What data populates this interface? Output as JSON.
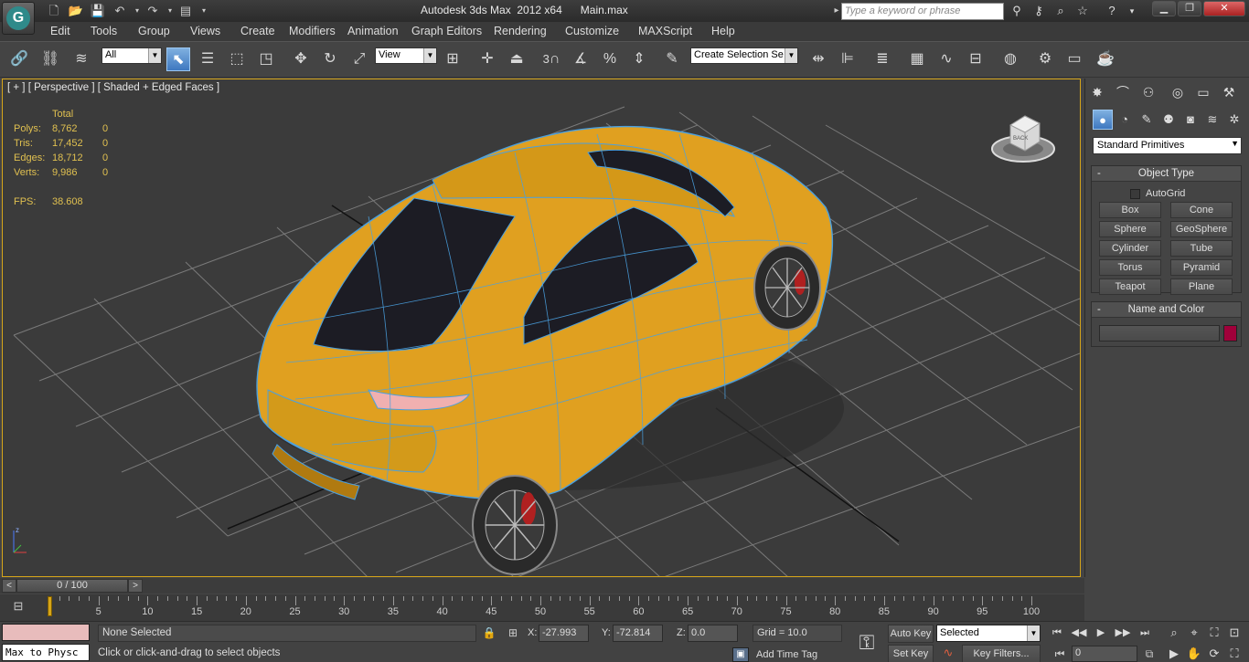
{
  "title_bar": {
    "title": "Autodesk 3ds Max  2012 x64      Main.max",
    "search_placeholder": "Type a keyword or phrase",
    "logo_glyph": "G"
  },
  "menu": {
    "items": [
      "Edit",
      "Tools",
      "Group",
      "Views",
      "Create",
      "Modifiers",
      "Animation",
      "Graph Editors",
      "Rendering",
      "Customize",
      "MAXScript",
      "Help"
    ]
  },
  "toolbar": {
    "selection_filter": "All",
    "reference_coord": "View",
    "named_selection_set": "Create Selection Se",
    "snap_label": "3",
    "percent_snap_label": "%"
  },
  "viewport": {
    "label": "[ + ] [ Perspective ] [ Shaded + Edged Faces ]",
    "stats": {
      "header": "Total",
      "rows": [
        {
          "label": "Polys:",
          "total": "8,762",
          "selected": "0"
        },
        {
          "label": "Tris:",
          "total": "17,452",
          "selected": "0"
        },
        {
          "label": "Edges:",
          "total": "18,712",
          "selected": "0"
        },
        {
          "label": "Verts:",
          "total": "9,986",
          "selected": "0"
        }
      ],
      "fps_label": "FPS:",
      "fps_value": "38.608"
    },
    "viewcube_label": "BACK",
    "colors": {
      "car_body": "#e0a020",
      "wireframe": "#4aa0e0",
      "glass": "#1c1c24",
      "grid": "#7a7a7a",
      "frame": "#d6a519"
    }
  },
  "command_panel": {
    "category": "Standard Primitives",
    "object_type": {
      "title": "Object Type",
      "autogrid": "AutoGrid",
      "buttons": [
        "Box",
        "Cone",
        "Sphere",
        "GeoSphere",
        "Cylinder",
        "Tube",
        "Torus",
        "Pyramid",
        "Teapot",
        "Plane"
      ]
    },
    "name_and_color": {
      "title": "Name and Color",
      "swatch_color": "#a0003a"
    }
  },
  "timeline": {
    "current": "0 / 100",
    "ticks": [
      "5",
      "10",
      "15",
      "20",
      "25",
      "30",
      "35",
      "40",
      "45",
      "50",
      "55",
      "60",
      "65",
      "70",
      "75",
      "80",
      "85",
      "90",
      "95",
      "100"
    ]
  },
  "status": {
    "maxscript_text": "Max to Physc",
    "selection": "None Selected",
    "prompt": "Click or click-and-drag to select objects",
    "x_label": "X:",
    "x_value": "-27.993",
    "y_label": "Y:",
    "y_value": "-72.814",
    "z_label": "Z:",
    "z_value": "0.0",
    "grid": "Grid = 10.0",
    "add_time_tag": "Add Time Tag",
    "auto_key": "Auto Key",
    "set_key": "Set Key",
    "selected_mode": "Selected",
    "key_filters": "Key Filters...",
    "frame": "0"
  }
}
